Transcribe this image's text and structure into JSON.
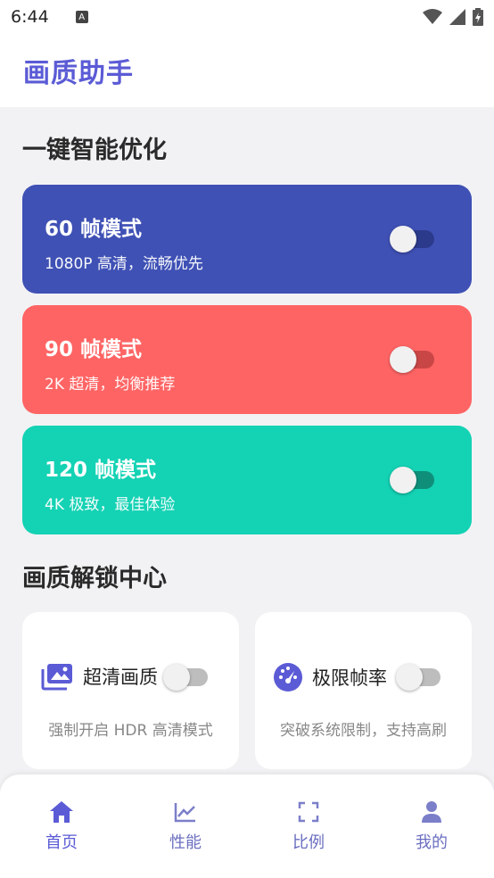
{
  "status_bar": {
    "time": "6:44",
    "notification_icon": "a-icon",
    "signal_icons": [
      "wifi-icon",
      "cell-signal-icon",
      "battery-charging-icon"
    ]
  },
  "app_bar": {
    "title": "画质助手"
  },
  "sections": {
    "smart_optimize": "一键智能优化",
    "unlock_center": "画质解锁中心"
  },
  "modes": [
    {
      "title": "60 帧模式",
      "subtitle": "1080P 高清，流畅优先",
      "color": "#3f51b5",
      "track_color": "#2c3a8c",
      "enabled": false
    },
    {
      "title": "90 帧模式",
      "subtitle": "2K 超清，均衡推荐",
      "color": "#ff6464",
      "track_color": "#c94646",
      "enabled": false
    },
    {
      "title": "120 帧模式",
      "subtitle": "4K 极致，最佳体验",
      "color": "#14d2b4",
      "track_color": "#0f8f7a",
      "enabled": false
    }
  ],
  "features": [
    {
      "label": "超清画质",
      "desc": "强制开启 HDR 高清模式",
      "icon": "photo-library-icon",
      "enabled": false
    },
    {
      "label": "极限帧率",
      "desc": "突破系统限制，支持高刷",
      "icon": "speedometer-icon",
      "enabled": false
    }
  ],
  "nav": [
    {
      "label": "首页",
      "icon": "home-icon",
      "selected": true
    },
    {
      "label": "性能",
      "icon": "chart-line-icon",
      "selected": false
    },
    {
      "label": "比例",
      "icon": "fullscreen-icon",
      "selected": false
    },
    {
      "label": "我的",
      "icon": "person-icon",
      "selected": false
    }
  ],
  "colors": {
    "accent": "#5b5bd6",
    "background": "#f2f2f4"
  }
}
